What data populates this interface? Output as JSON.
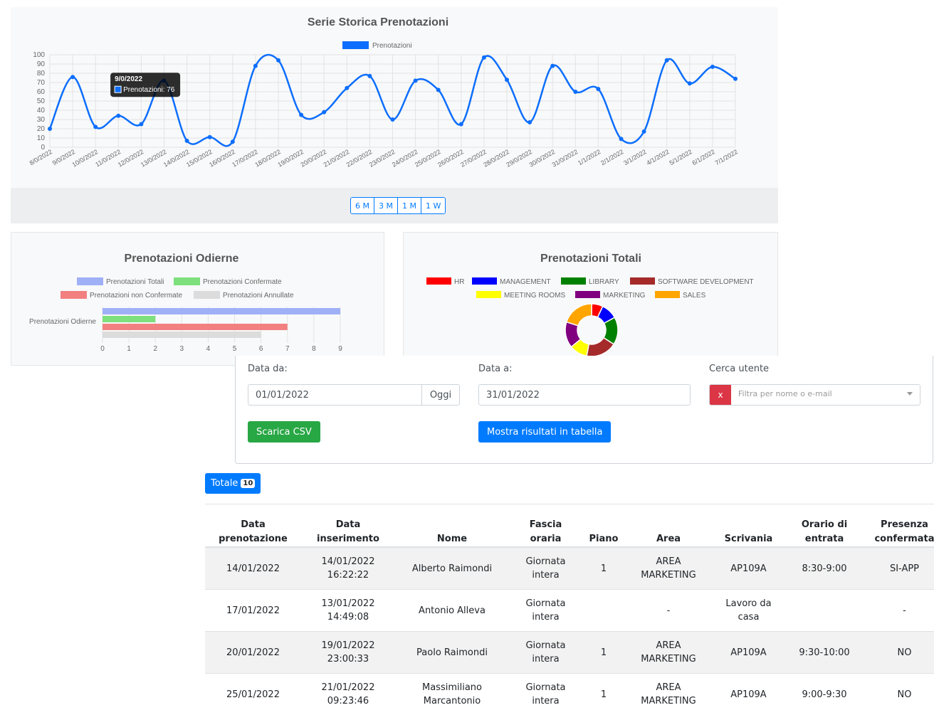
{
  "timeseries": {
    "chart_data": {
      "type": "line",
      "title": "Serie Storica Prenotazioni",
      "series": [
        {
          "name": "Prenotazioni",
          "color": "#0d6efd",
          "values": [
            20,
            76,
            22,
            34,
            25,
            72,
            7,
            11,
            6,
            88,
            94,
            35,
            38,
            64,
            77,
            30,
            72,
            62,
            25,
            97,
            73,
            27,
            88,
            60,
            63,
            9,
            17,
            94,
            69,
            87,
            74
          ]
        }
      ],
      "x": [
        "8/0/2022",
        "9/0/2022",
        "10/0/2022",
        "11/0/2022",
        "12/0/2022",
        "13/0/2022",
        "14/0/2022",
        "15/0/2022",
        "16/0/2022",
        "17/0/2022",
        "18/0/2022",
        "19/0/2022",
        "20/0/2022",
        "21/0/2022",
        "22/0/2022",
        "23/0/2022",
        "24/0/2022",
        "25/0/2022",
        "26/0/2022",
        "27/0/2022",
        "28/0/2022",
        "29/0/2022",
        "30/0/2022",
        "31/0/2022",
        "1/1/2022",
        "2/1/2022",
        "3/1/2022",
        "4/1/2022",
        "5/1/2022",
        "6/1/2022",
        "7/1/2022"
      ],
      "y_ticks": [
        "0",
        "10",
        "20",
        "30",
        "40",
        "50",
        "60",
        "70",
        "80",
        "90",
        "100"
      ],
      "ylim": [
        0,
        100
      ],
      "grid": true,
      "legend": "top"
    },
    "tooltip": {
      "title": "9/0/2022",
      "text": "Prenotazioni: 76"
    },
    "range_buttons": [
      "6 M",
      "3 M",
      "1 M",
      "1 W"
    ]
  },
  "today_chart": {
    "chart_data": {
      "type": "bar",
      "orientation": "horizontal",
      "title": "Prenotazioni Odierne",
      "categories": [
        "Prenotazioni Odierne"
      ],
      "series": [
        {
          "name": "Prenotazioni Totali",
          "color": "#9fb0f7",
          "values": [
            9
          ]
        },
        {
          "name": "Prenotazioni Confermate",
          "color": "#7de07d",
          "values": [
            2
          ]
        },
        {
          "name": "Prenotazioni non Confermate",
          "color": "#f28080",
          "values": [
            7
          ]
        },
        {
          "name": "Prenotazioni Annullate",
          "color": "#dcdcdc",
          "values": [
            6
          ]
        }
      ],
      "x_ticks": [
        "0",
        "1",
        "2",
        "3",
        "4",
        "5",
        "6",
        "7",
        "8",
        "9"
      ],
      "xlim": [
        0,
        9
      ],
      "legend": "top"
    }
  },
  "total_chart": {
    "chart_data": {
      "type": "pie",
      "variant": "doughnut",
      "title": "Prenotazioni Totali",
      "categories": [
        "HR",
        "MANAGEMENT",
        "LIBRARY",
        "SOFTWARE DEVELOPMENT",
        "MEETING ROOMS",
        "MARKETING",
        "SALES"
      ],
      "colors": [
        "#ff0000",
        "#0000ff",
        "#008000",
        "#a52a2a",
        "#ffff00",
        "#800080",
        "#ffa500"
      ],
      "values": [
        7,
        10,
        17,
        19,
        11,
        16,
        20
      ],
      "legend": "top"
    }
  },
  "filters": {
    "date_from_label": "Data da:",
    "date_from_value": "01/01/2022",
    "today_button": "Oggi",
    "date_to_label": "Data a:",
    "date_to_value": "31/01/2022",
    "search_user_label": "Cerca utente",
    "clear_label": "x",
    "user_placeholder": "Filtra per nome o e-mail",
    "csv_button": "Scarica CSV",
    "show_button": "Mostra risultati in tabella"
  },
  "totals": {
    "label": "Totale",
    "count": "10"
  },
  "table": {
    "headers": [
      [
        "Data",
        "prenotazione"
      ],
      [
        "Data",
        "inserimento"
      ],
      [
        "Nome"
      ],
      [
        "Fascia",
        "oraria"
      ],
      [
        "Piano"
      ],
      [
        "Area"
      ],
      [
        "Scrivania"
      ],
      [
        "Orario di",
        "entrata"
      ],
      [
        "Presenza",
        "confermata"
      ]
    ],
    "rows": [
      [
        "14/01/2022",
        "14/01/2022 16:22:22",
        "Alberto Raimondi",
        "Giornata intera",
        "1",
        "AREA MARKETING",
        "AP109A",
        "8:30-9:00",
        "SI-APP"
      ],
      [
        "17/01/2022",
        "13/01/2022 14:49:08",
        "Antonio Alleva",
        "Giornata intera",
        "",
        "-",
        "Lavoro da casa",
        "",
        "-"
      ],
      [
        "20/01/2022",
        "19/01/2022 23:00:33",
        "Paolo Raimondi",
        "Giornata intera",
        "1",
        "AREA MARKETING",
        "AP109A",
        "9:30-10:00",
        "NO"
      ],
      [
        "25/01/2022",
        "21/01/2022 09:23:46",
        "Massimiliano Marcantonio",
        "Giornata intera",
        "1",
        "AREA MARKETING",
        "AP109A",
        "9:00-9:30",
        "NO"
      ]
    ]
  }
}
